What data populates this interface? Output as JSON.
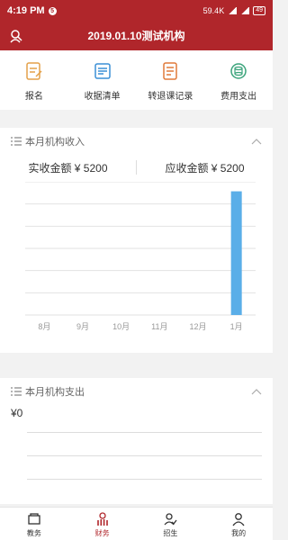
{
  "status_bar": {
    "time": "4:19 PM",
    "notif": "5",
    "net_speed": "59.4K",
    "battery": "49"
  },
  "header": {
    "title": "2019.01.10测试机构",
    "left_icon": "user-search-icon"
  },
  "quick_nav": [
    {
      "label": "报名",
      "icon": "signup-icon",
      "color": "#e4a14a"
    },
    {
      "label": "收据清单",
      "icon": "receipt-icon",
      "color": "#3a8fd6"
    },
    {
      "label": "转退课记录",
      "icon": "transfer-record-icon",
      "color": "#e07a3a"
    },
    {
      "label": "费用支出",
      "icon": "expense-icon",
      "color": "#3aa37a"
    }
  ],
  "income_card": {
    "title": "本月机构收入",
    "actual_label": "实收金额 ¥ 5200",
    "receivable_label": "应收金额 ¥ 5200"
  },
  "chart_data": {
    "type": "bar",
    "categories": [
      "8月",
      "9月",
      "10月",
      "11月",
      "12月",
      "1月"
    ],
    "values": [
      0,
      0,
      0,
      0,
      0,
      5200
    ],
    "ylim": [
      0,
      5600
    ],
    "grid": true,
    "bar_color": "#5aaee8"
  },
  "expense_card": {
    "title": "本月机构支出",
    "value": "¥0"
  },
  "tab_bar": [
    {
      "label": "教务",
      "icon": "teaching-icon",
      "active": false
    },
    {
      "label": "财务",
      "icon": "finance-icon",
      "active": true
    },
    {
      "label": "招生",
      "icon": "enroll-icon",
      "active": false
    },
    {
      "label": "我的",
      "icon": "profile-icon",
      "active": false
    }
  ],
  "colors": {
    "brand": "#b0262b"
  }
}
